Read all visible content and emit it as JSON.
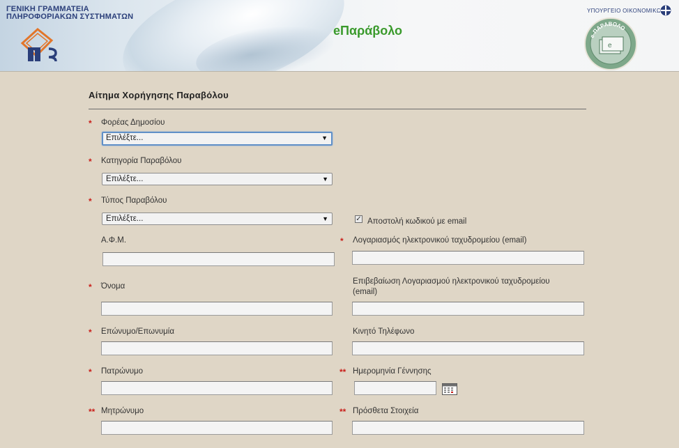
{
  "header": {
    "org_line1": "ΓΕΝΙΚΗ ΓΡΑΜΜΑΤΕΙΑ",
    "org_line2": "ΠΛΗΡΟΦΟΡΙΑΚΩΝ ΣΥΣΤΗΜΑΤΩΝ",
    "app_title": "eΠαράβολο",
    "ministry": "ΥΠΟΥΡΓΕΙΟ ΟΙΚΟΝΟΜΙΚΩΝ",
    "seal_text": "e-ΠΑΡΑΒΟΛΟ"
  },
  "form": {
    "title": "Αίτημα Χορήγησης Παραβόλου",
    "required_mark": "*",
    "double_required_mark": "**",
    "agency": {
      "label": "Φορέας Δημοσίου",
      "value": "Επιλέξτε..."
    },
    "category": {
      "label": "Κατηγορία Παραβόλου",
      "value": "Επιλέξτε..."
    },
    "type": {
      "label": "Τύπος Παραβόλου",
      "value": "Επιλέξτε..."
    },
    "send_code_email": {
      "label": "Αποστολή κωδικού με email",
      "checked": true
    },
    "afm": {
      "label": "Α.Φ.Μ.",
      "value": ""
    },
    "email": {
      "label": "Λογαριασμός ηλεκτρονικού ταχυδρομείου (email)",
      "value": ""
    },
    "first_name": {
      "label": "Όνομα",
      "value": ""
    },
    "email_confirm": {
      "label_line1": "Επιβεβαίωση Λογαριασμού ηλεκτρονικού ταχυδρομείου",
      "label_line2": "(email)",
      "value": ""
    },
    "surname": {
      "label": "Επώνυμο/Επωνυμία",
      "value": ""
    },
    "mobile": {
      "label": "Κινητό Τηλέφωνο",
      "value": ""
    },
    "father_name": {
      "label": "Πατρώνυμο",
      "value": ""
    },
    "birth_date": {
      "label": "Ημερομηνία Γέννησης",
      "value": ""
    },
    "mother_name": {
      "label": "Μητρώνυμο",
      "value": ""
    },
    "extra_info": {
      "label": "Πρόσθετα Στοιχεία",
      "value": ""
    }
  },
  "colors": {
    "background": "#dfd6c6",
    "required": "#c9201b",
    "app_title": "#3a9a2c",
    "org_text": "#2b3f7a"
  }
}
